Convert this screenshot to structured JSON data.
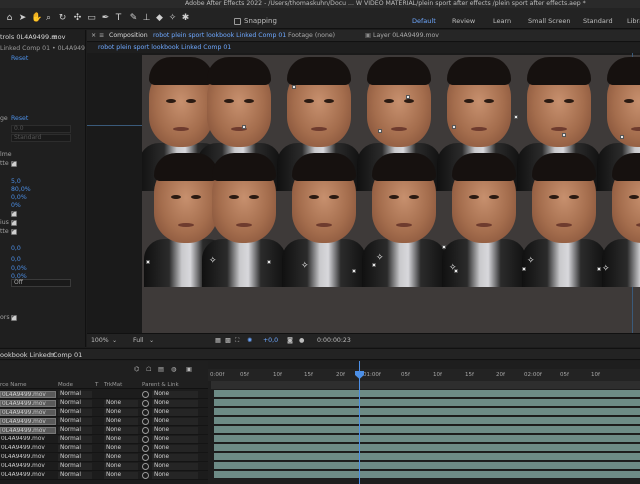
{
  "app": {
    "title": "Adobe After Effects 2022 - /Users/thomaskuhn/Docu ... W VIDEO MATERIAL/plein sport after effects /plein sport after effects.aep *"
  },
  "toolbar": {
    "tools": [
      {
        "icon": "home-icon",
        "glyph": "⌂"
      },
      {
        "icon": "selection-arrow-icon",
        "glyph": "➤"
      },
      {
        "icon": "hand-icon",
        "glyph": "✋"
      },
      {
        "icon": "zoom-icon",
        "glyph": "⌕"
      },
      {
        "icon": "rotate-icon",
        "glyph": "↻"
      },
      {
        "icon": "camera-orbit-icon",
        "glyph": "✣"
      },
      {
        "icon": "rectangle-icon",
        "glyph": "▭"
      },
      {
        "icon": "pen-icon",
        "glyph": "✒"
      },
      {
        "icon": "type-icon",
        "glyph": "T"
      },
      {
        "icon": "brush-icon",
        "glyph": "✎"
      },
      {
        "icon": "clone-stamp-icon",
        "glyph": "⊥"
      },
      {
        "icon": "eraser-icon",
        "glyph": "◆"
      },
      {
        "icon": "roto-brush-icon",
        "glyph": "✧"
      },
      {
        "icon": "puppet-pin-icon",
        "glyph": "✱"
      }
    ],
    "snapping_label": "Snapping",
    "workspaces": [
      "Default",
      "Review",
      "Learn",
      "Small Screen",
      "Standard",
      "Libra"
    ],
    "active_workspace": "Default"
  },
  "effect_controls": {
    "tab": "trols 0L4A9499.mov",
    "layer": "Linked Comp 01 • 0L4A9499.mov",
    "reset1": "Reset",
    "ge_label": "ge",
    "reset2": "Reset",
    "val_zero": "0.0",
    "val_standard": "Standard",
    "lines": {
      "lme": "lme",
      "tte1": "tte",
      "v50": "5,0",
      "v80": "80,0%",
      "v0a": "0,0%",
      "v0b": "0%",
      "ius": "ius",
      "tte2": "tte",
      "v00a": "0,0",
      "v00b": "0,0",
      "v00c": "0,0%",
      "v00d": "0,0%",
      "off": "Off",
      "ors": "ors"
    }
  },
  "composition": {
    "tab_label": "Composition",
    "tab_comp": "robot plein sport lookbook Linked Comp 01",
    "footage_tab": "Footage (none)",
    "layer_tab": "Layer 0L4A9499.mov",
    "breadcrumb": "robot plein sport lookbook Linked Comp 01",
    "viewer": {
      "zoom": "100%",
      "resolution": "Full",
      "exposure": "+0,0",
      "timecode": "0:00:00:23"
    }
  },
  "timeline": {
    "tab": "ookbook Linked Comp 01",
    "columns": {
      "source_name": "rce Name",
      "mode": "Mode",
      "t": "T",
      "trkmat": "TrkMat",
      "parent_link": "Parent & Link"
    },
    "ruler": [
      "0:00f",
      "05f",
      "10f",
      "15f",
      "20f",
      "01:00f",
      "05f",
      "10f",
      "15f",
      "20f",
      "02:00f",
      "05f",
      "10f"
    ],
    "layers": [
      {
        "name": "0L4A9499.mov",
        "selected": true,
        "mode": "Normal",
        "trkmat": "",
        "parent": "None"
      },
      {
        "name": "0L4A9499.mov",
        "selected": true,
        "mode": "Normal",
        "trkmat": "None",
        "parent": "None"
      },
      {
        "name": "0L4A9499.mov",
        "selected": true,
        "mode": "Normal",
        "trkmat": "None",
        "parent": "None"
      },
      {
        "name": "0L4A9499.mov",
        "selected": true,
        "mode": "Normal",
        "trkmat": "None",
        "parent": "None"
      },
      {
        "name": "0L4A9499.mov",
        "selected": true,
        "mode": "Normal",
        "trkmat": "None",
        "parent": "None"
      },
      {
        "name": "0L4A9499.mov",
        "selected": false,
        "mode": "Normal",
        "trkmat": "None",
        "parent": "None"
      },
      {
        "name": "0L4A9499.mov",
        "selected": false,
        "mode": "Normal",
        "trkmat": "None",
        "parent": "None"
      },
      {
        "name": "0L4A9499.mov",
        "selected": false,
        "mode": "Normal",
        "trkmat": "None",
        "parent": "None"
      },
      {
        "name": "0L4A9499.mov",
        "selected": false,
        "mode": "Normal",
        "trkmat": "None",
        "parent": "None"
      },
      {
        "name": "0L4A9499.mov",
        "selected": false,
        "mode": "Normal",
        "trkmat": "None",
        "parent": "None"
      }
    ]
  }
}
